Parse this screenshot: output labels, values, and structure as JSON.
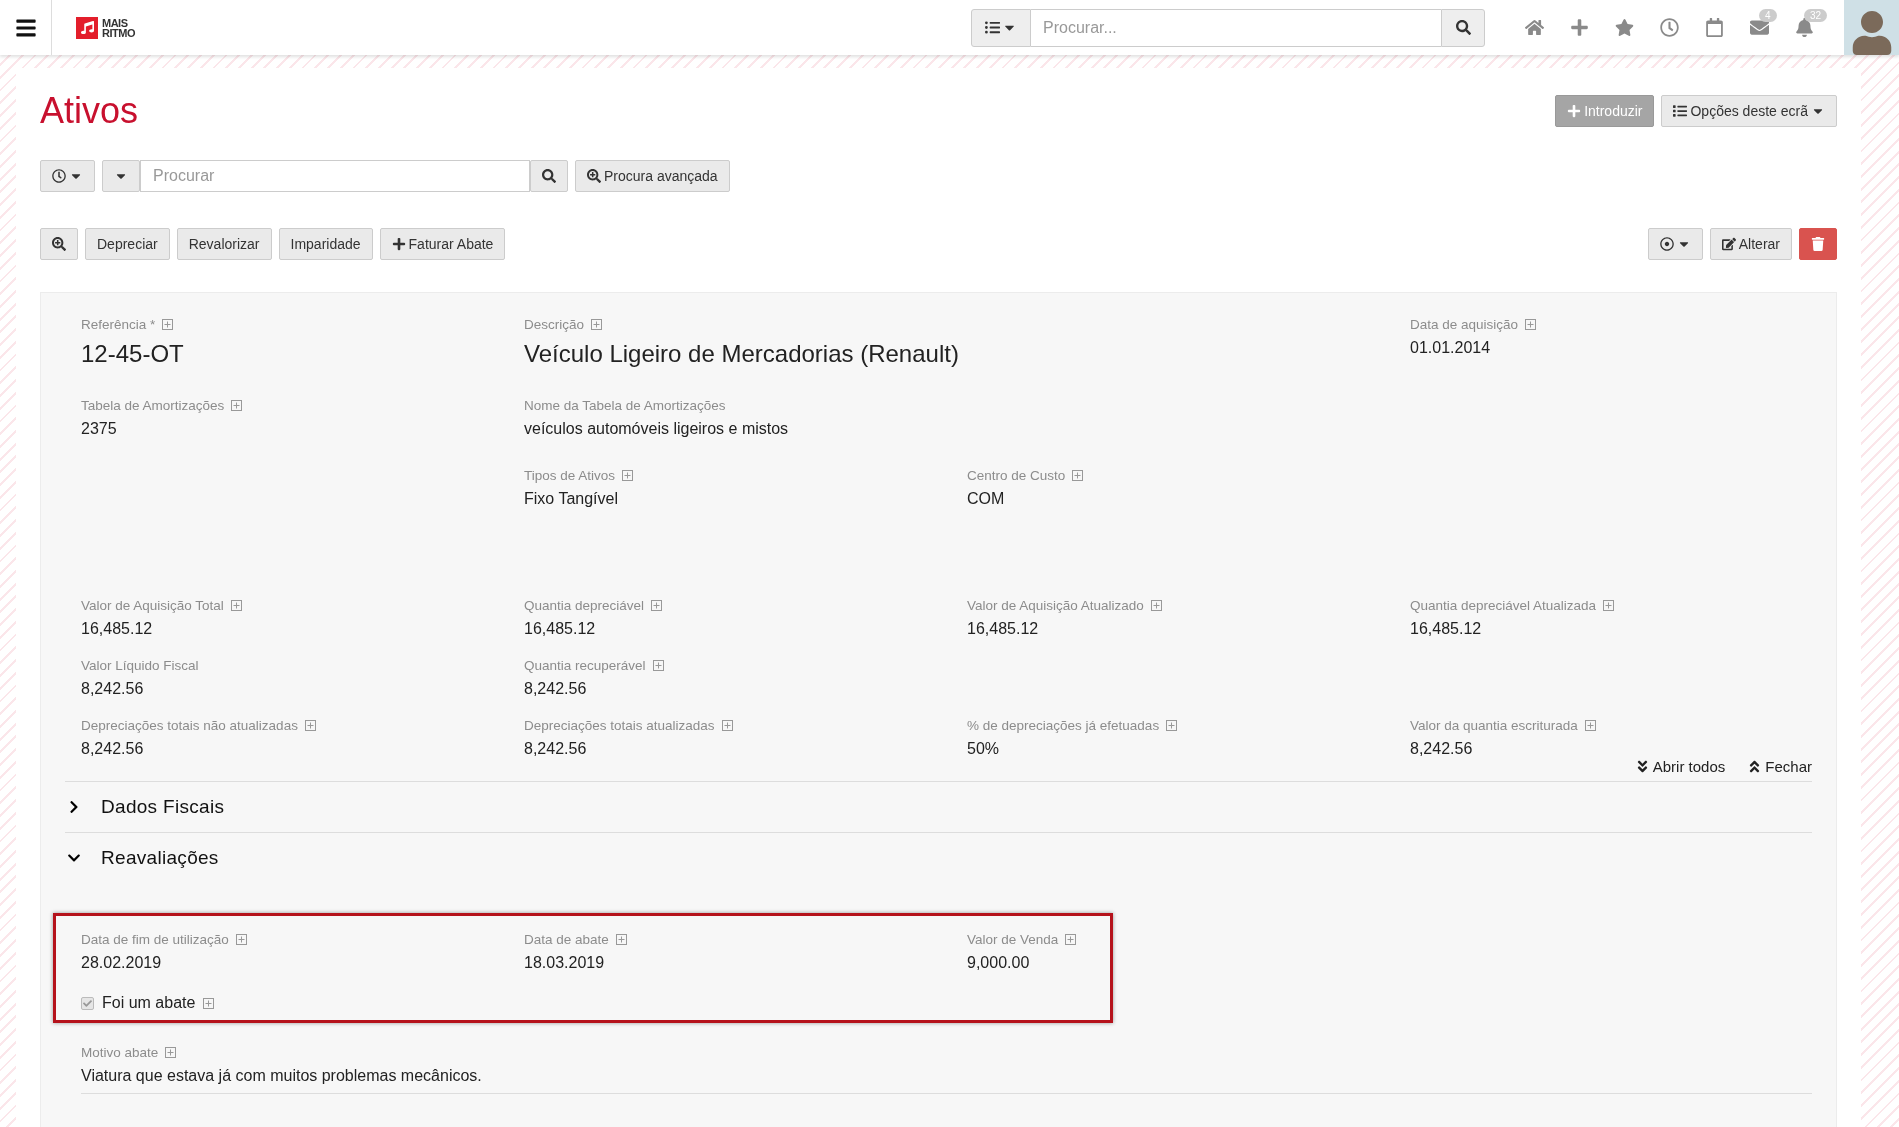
{
  "topbar": {
    "logo": "MAIS\nRITMO",
    "search": {
      "placeholder": "Procurar..."
    },
    "badges": {
      "mail": "4",
      "notifications": "32"
    }
  },
  "page": {
    "title": "Ativos",
    "buttons": [
      {
        "kind": "primary",
        "label": "Introduzir"
      },
      {
        "kind": "menu",
        "label": "Opções deste ecrã"
      }
    ]
  },
  "search": {
    "placeholder": "Procurar",
    "advanced": "Procura avançada"
  },
  "actions": [
    "Depreciar",
    "Revalorizar",
    "Imparidade",
    "Faturar Abate"
  ],
  "edit_button": "Alterar",
  "groups": [
    [
      [
        {
          "label": "Referência *",
          "info_icon": true,
          "value": "12-45-OT",
          "kind": "large"
        },
        {
          "label": "Descrição",
          "info_icon": true,
          "value": "Veículo Ligeiro de Mercadorias (Renault)",
          "kind": "large"
        },
        {
          "kind": "empty"
        },
        {
          "label": "Data de aquisição",
          "info_icon": true,
          "value": "01.01.2014",
          "kind": "normal"
        }
      ],
      [
        {
          "label": "Tabela de Amortizações",
          "info_icon": true,
          "value": "2375",
          "kind": "normal"
        },
        {
          "label": "Nome da Tabela de Amortizações",
          "info_icon": false,
          "value": "veículos automóveis ligeiros e mistos",
          "kind": "normal"
        },
        {
          "kind": "empty"
        },
        {
          "kind": "empty"
        }
      ],
      [
        {
          "kind": "empty"
        },
        {
          "label": "Tipos de Ativos",
          "info_icon": true,
          "value": "Fixo Tangível",
          "kind": "normal"
        },
        {
          "label": "Centro de Custo",
          "info_icon": true,
          "value": "COM",
          "kind": "normal"
        },
        {
          "kind": "empty"
        }
      ]
    ],
    [
      [
        {
          "label": "Valor de Aquisição Total",
          "info_icon": true,
          "value": "16,485.12",
          "kind": "normal"
        },
        {
          "label": "Quantia depreciável",
          "info_icon": true,
          "value": "16,485.12",
          "kind": "normal"
        },
        {
          "label": "Valor de Aquisição Atualizado",
          "info_icon": true,
          "value": "16,485.12",
          "kind": "normal"
        },
        {
          "label": "Quantia depreciável Atualizada",
          "info_icon": true,
          "value": "16,485.12",
          "kind": "normal"
        }
      ],
      [
        {
          "label": "Valor Líquido Fiscal",
          "info_icon": false,
          "value": "8,242.56",
          "kind": "normal"
        },
        {
          "label": "Quantia recuperável",
          "info_icon": true,
          "value": "8,242.56",
          "kind": "normal"
        },
        {
          "kind": "empty"
        },
        {
          "kind": "empty"
        }
      ],
      [
        {
          "label": "Depreciações totais não atualizadas",
          "info_icon": true,
          "value": "8,242.56",
          "kind": "normal"
        },
        {
          "label": "Depreciações totais atualizadas",
          "info_icon": true,
          "value": "8,242.56",
          "kind": "normal"
        },
        {
          "label": "% de depreciações já efetuadas",
          "info_icon": true,
          "value": "50%",
          "kind": "normal"
        },
        {
          "label": "Valor da quantia escriturada",
          "info_icon": true,
          "value": "8,242.56",
          "kind": "normal"
        }
      ]
    ]
  ],
  "links": [
    "Abrir todos",
    "Fechar"
  ],
  "sections": [
    {
      "title": "Dados Fiscais",
      "expanded": false
    },
    {
      "title": "Reavaliações",
      "expanded": true
    }
  ],
  "highlighted": {
    "fields": [
      {
        "label": "Data de fim de utilização",
        "info_icon": true,
        "value": "28.02.2019",
        "kind": "normal"
      },
      {
        "label": "Data de abate",
        "info_icon": true,
        "value": "18.03.2019",
        "kind": "normal"
      },
      {
        "label": "Valor de Venda",
        "info_icon": true,
        "value": "9,000.00",
        "kind": "normal"
      }
    ],
    "checkbox": {
      "label": "Foi um abate",
      "checked": true,
      "info_icon": true
    }
  },
  "reason": {
    "label": "Motivo abate",
    "info_icon": true,
    "value": "Viatura que estava já com muitos problemas mecânicos.",
    "kind": "normal"
  }
}
